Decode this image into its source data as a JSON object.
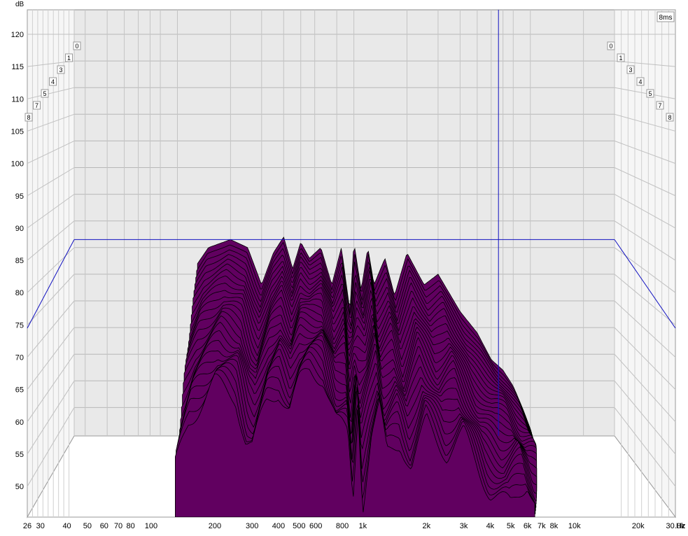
{
  "chart_data": {
    "type": "area",
    "subtype": "waterfall",
    "yunit": "dB",
    "xunit": "Hz",
    "time_readout": "8ms",
    "ylim": [
      45,
      122
    ],
    "xlim": [
      26,
      30000
    ],
    "x_scale": "log",
    "grid": true,
    "fill_color": "#610060",
    "cursor_color": "#1010c0",
    "cursor_frequency": 6600,
    "cursor_level": 81.5,
    "yticks": [
      {
        "v": 50,
        "label": "50"
      },
      {
        "v": 55,
        "label": "55"
      },
      {
        "v": 60,
        "label": "60"
      },
      {
        "v": 65,
        "label": "65"
      },
      {
        "v": 70,
        "label": "70"
      },
      {
        "v": 75,
        "label": "75"
      },
      {
        "v": 80,
        "label": "80"
      },
      {
        "v": 85,
        "label": "85"
      },
      {
        "v": 90,
        "label": "90"
      },
      {
        "v": 95,
        "label": "95"
      },
      {
        "v": 100,
        "label": "100"
      },
      {
        "v": 105,
        "label": "105"
      },
      {
        "v": 110,
        "label": "110"
      },
      {
        "v": 115,
        "label": "115"
      },
      {
        "v": 120,
        "label": "120"
      }
    ],
    "xticks": [
      {
        "f": 26,
        "label": "26"
      },
      {
        "f": 30,
        "label": "30"
      },
      {
        "f": 40,
        "label": "40"
      },
      {
        "f": 50,
        "label": "50"
      },
      {
        "f": 60,
        "label": "60"
      },
      {
        "f": 70,
        "label": "70"
      },
      {
        "f": 80,
        "label": "80"
      },
      {
        "f": 100,
        "label": "100"
      },
      {
        "f": 200,
        "label": "200"
      },
      {
        "f": 300,
        "label": "300"
      },
      {
        "f": 400,
        "label": "400"
      },
      {
        "f": 500,
        "label": "500"
      },
      {
        "f": 600,
        "label": "600"
      },
      {
        "f": 800,
        "label": "800"
      },
      {
        "f": 1000,
        "label": "1k"
      },
      {
        "f": 2000,
        "label": "2k"
      },
      {
        "f": 3000,
        "label": "3k"
      },
      {
        "f": 4000,
        "label": "4k"
      },
      {
        "f": 5000,
        "label": "5k"
      },
      {
        "f": 6000,
        "label": "6k"
      },
      {
        "f": 7000,
        "label": "7k"
      },
      {
        "f": 8000,
        "label": "8k"
      },
      {
        "f": 10000,
        "label": "10k"
      },
      {
        "f": 20000,
        "label": "20k"
      },
      {
        "f": 30000,
        "label": "30.0k"
      }
    ],
    "depth_labels_left": [
      "0",
      "1",
      "3",
      "4",
      "5",
      "7",
      "8"
    ],
    "depth_labels_right": [
      "0",
      "1",
      "3",
      "4",
      "5",
      "7",
      "8"
    ],
    "series": [
      {
        "time_index": 0,
        "x": [
          130,
          150,
          200,
          250,
          300,
          350,
          400,
          450,
          500,
          560,
          650,
          750,
          850,
          950,
          1000,
          1100,
          1200,
          1300,
          1500,
          1700,
          2000,
          2500,
          3000,
          4000,
          5000,
          6000,
          7000,
          8000,
          9000,
          10000
        ],
        "y": [
          77,
          80,
          81.5,
          80,
          73,
          79,
          82,
          76,
          81,
          78,
          80,
          73,
          80,
          68,
          81,
          72,
          80,
          73,
          78,
          71,
          79,
          73,
          75,
          68,
          64,
          59,
          57,
          54,
          50,
          46
        ]
      },
      {
        "time_index": 25,
        "x": [
          130,
          150,
          200,
          250,
          280,
          300,
          350,
          400,
          450,
          500,
          560,
          650,
          750,
          850,
          900,
          950,
          1000,
          1100,
          1200,
          1300,
          1500,
          1700,
          2000,
          2500,
          3000,
          4000,
          5000,
          6000,
          7000,
          8000,
          9000,
          10000
        ],
        "y": [
          53,
          60,
          66,
          64,
          57,
          56,
          63,
          65,
          62,
          66,
          68,
          67,
          60,
          58,
          48,
          63,
          47,
          58,
          62,
          55,
          57,
          53,
          60,
          55,
          58,
          49,
          47,
          51,
          45,
          47,
          43,
          40
        ]
      }
    ]
  }
}
